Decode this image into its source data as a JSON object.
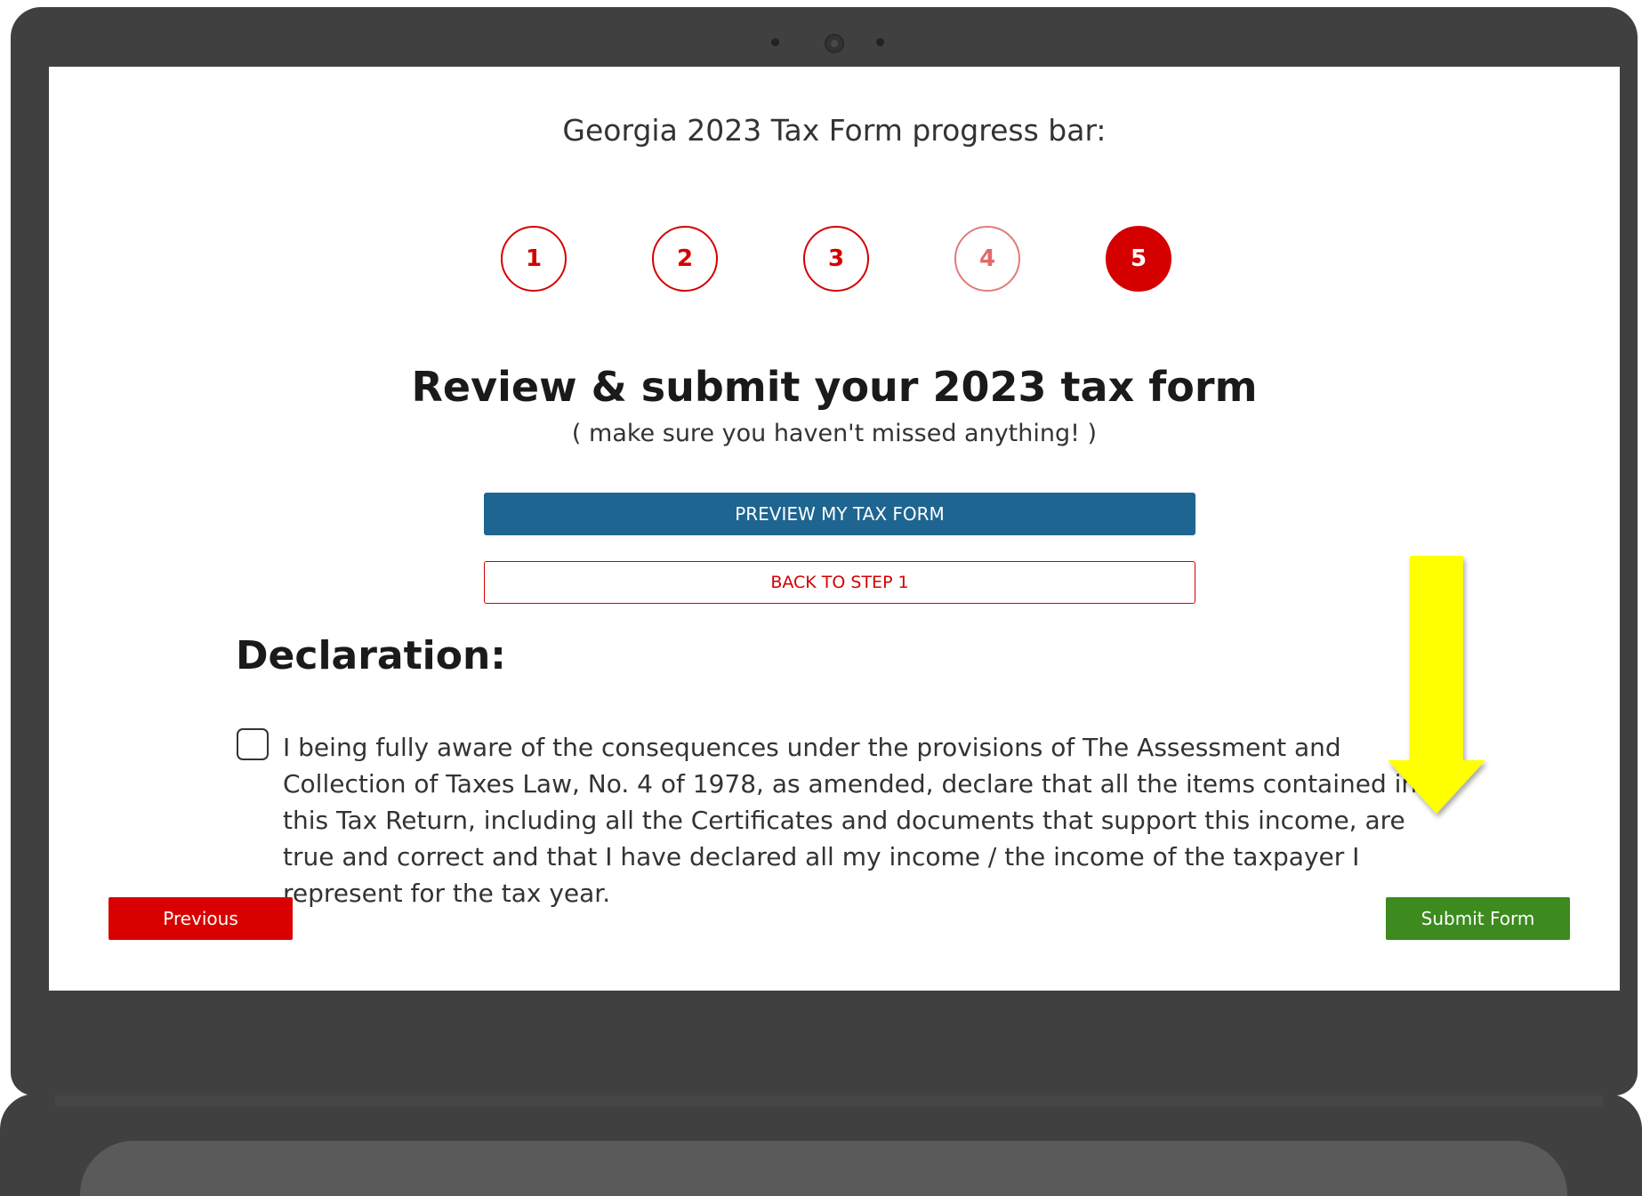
{
  "progress": {
    "title": "Georgia 2023 Tax Form progress bar:",
    "steps": [
      "1",
      "2",
      "3",
      "4",
      "5"
    ],
    "current_step": 5
  },
  "review": {
    "title": "Review & submit your 2023 tax form",
    "subtitle": "( make sure you haven't missed anything! )",
    "preview_button": "PREVIEW MY TAX FORM",
    "back_button": "BACK TO STEP 1"
  },
  "declaration": {
    "heading": "Declaration:",
    "text": "I being fully aware of the consequences under the provisions of The Assessment and Collection of Taxes Law, No. 4 of 1978, as amended, declare that all the items contained in this Tax Return, including all the Certificates and documents that support this income, are true and correct and that I have declared all my income / the income of the taxpayer I represent for the tax year.",
    "checked": false
  },
  "nav": {
    "previous_button": "Previous",
    "submit_button": "Submit Form"
  },
  "colors": {
    "brand_red": "#d40000",
    "preview_blue": "#1e6591",
    "submit_green": "#3d8a1f",
    "highlight_arrow": "#ffff00",
    "device_body": "#404040"
  }
}
